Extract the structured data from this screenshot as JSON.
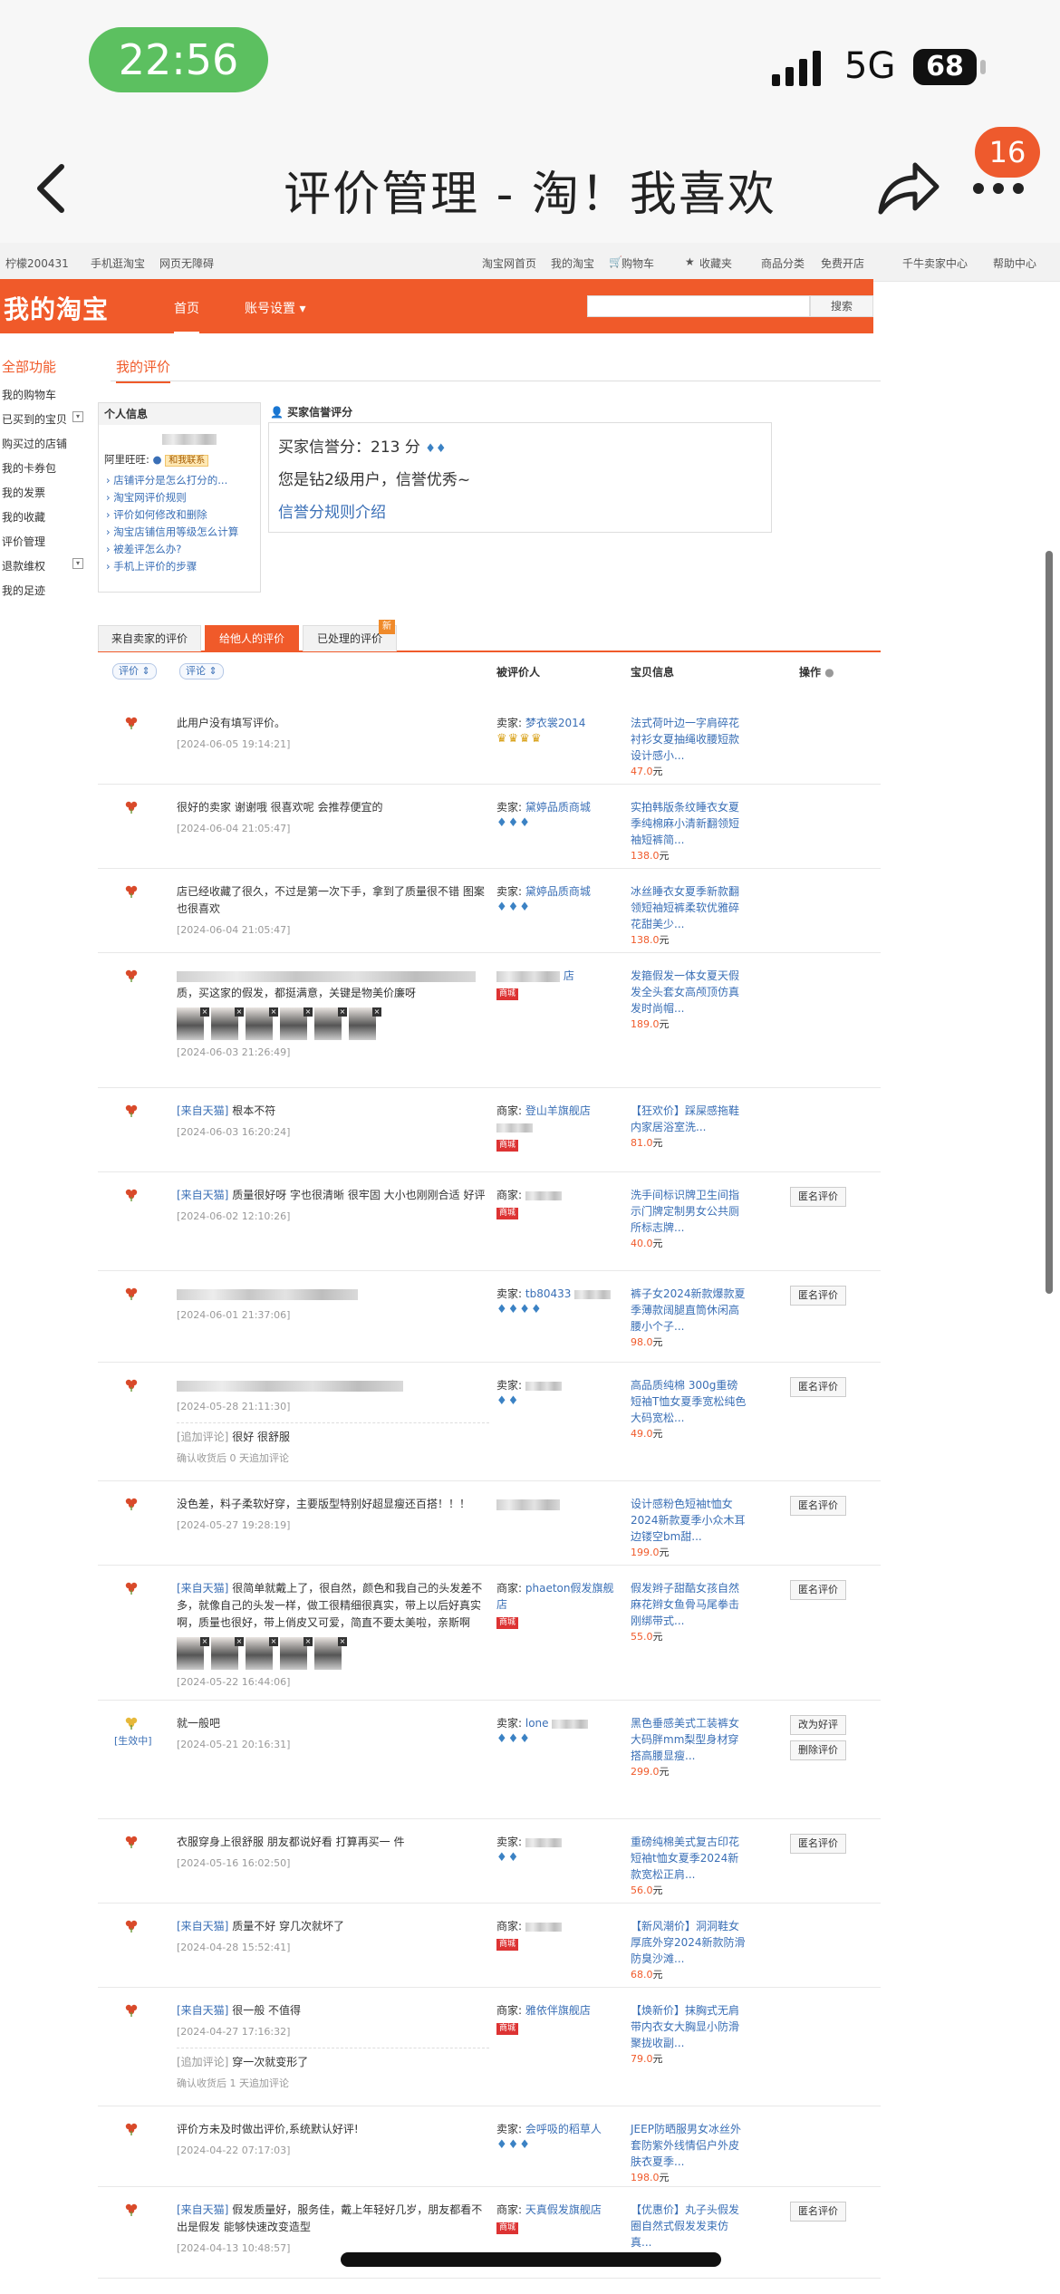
{
  "status_bar": {
    "time": "22:56",
    "network": "5G",
    "battery": "68"
  },
  "nav": {
    "title": "评价管理 - 淘！我喜欢",
    "badge": "16"
  },
  "topbar": {
    "user": "柠檬200431",
    "mobile": "手机逛淘宝",
    "accessible": "网页无障碍",
    "links": [
      "淘宝网首页",
      "我的淘宝",
      "购物车",
      "收藏夹",
      "商品分类",
      "免费开店",
      "千牛卖家中心",
      "帮助中心"
    ]
  },
  "header": {
    "logo": "我的淘宝",
    "home": "首页",
    "account": "账号设置",
    "search_btn": "搜索"
  },
  "sidebar": {
    "title": "全部功能",
    "items": [
      "我的购物车",
      "已买到的宝贝",
      "购买过的店铺",
      "我的卡券包",
      "我的发票",
      "我的收藏",
      "评价管理",
      "退款维权",
      "我的足迹"
    ]
  },
  "page_tab": "我的评价",
  "personal": {
    "title": "个人信息",
    "aliwangwang_label": "阿里旺旺:",
    "contact": "和我联系",
    "links": [
      "店铺评分是怎么打分的...",
      "淘宝网评价规则",
      "评价如何修改和删除",
      "淘宝店铺信用等级怎么计算",
      "被差评怎么办?",
      "手机上评价的步骤"
    ]
  },
  "credit": {
    "title": "买家信誉评分",
    "score_line": "买家信誉分：213 分",
    "level_line": "您是钻2级用户，信誉优秀~",
    "rules_link": "信誉分规则介绍"
  },
  "tabs": {
    "t1": "来自卖家的评价",
    "t2": "给他人的评价",
    "t3": "已处理的评价",
    "new": "新"
  },
  "columns": {
    "rating": "评价",
    "comment": "评论",
    "target": "被评价人",
    "item": "宝贝信息",
    "ops": "操作"
  },
  "yuan": "元",
  "reviews": [
    {
      "text": "此用户没有填写评价。",
      "date": "[2024-06-05 19:14:21]",
      "label": "卖家:",
      "name": "梦衣裳2014",
      "badge": "",
      "marks": "♛♛♛♛",
      "item": "法式荷叶边一字肩碎花衬衫女夏抽绳收腰短款设计感小...",
      "price": "47.0",
      "op": ""
    },
    {
      "text": "很好的卖家 谢谢哦 很喜欢呢 会推荐便宜的",
      "date": "[2024-06-04 21:05:47]",
      "label": "卖家:",
      "name": "黛婷品质商城",
      "badge": "",
      "marks": "♦♦♦",
      "item": "实拍韩版条纹睡衣女夏季纯棉麻小清新翻领短袖短裤简...",
      "price": "138.0",
      "op": ""
    },
    {
      "text": "店已经收藏了很久，不过是第一次下手，拿到了质量很不错 图案也很喜欢",
      "date": "[2024-06-04 21:05:47]",
      "label": "卖家:",
      "name": "黛婷品质商城",
      "badge": "",
      "marks": "♦♦♦",
      "item": "冰丝睡衣女夏季新款翻领短袖短裤柔软优雅碎花甜美少...",
      "price": "138.0",
      "op": ""
    },
    {
      "text": "质，买这家的假发，都挺满意，关键是物美价廉呀",
      "date": "[2024-06-03 21:26:49]",
      "label": "",
      "name": "店",
      "badge": "商城",
      "marks": "",
      "item": "发箍假发一体女夏天假发全头套女高颅顶仿真发时尚帽...",
      "price": "189.0",
      "op": ""
    },
    {
      "prefix": "[来自天猫]",
      "text": "根本不符",
      "date": "[2024-06-03 16:20:24]",
      "label": "商家:",
      "name": "登山羊旗舰店",
      "badge": "商城",
      "marks": "",
      "item": "【狂欢价】踩屎感拖鞋内家居浴室洗...",
      "price": "81.0",
      "op": ""
    },
    {
      "prefix": "[来自天猫]",
      "text": "质量很好呀 字也很清晰 很牢固 大小也刚刚合适 好评",
      "date": "[2024-06-02 12:10:26]",
      "label": "商家:",
      "name": "",
      "badge": "商城",
      "marks": "",
      "item": "洗手间标识牌卫生间指示门牌定制男女公共厕所标志牌...",
      "price": "40.0",
      "op": "匿名评价"
    },
    {
      "text": "",
      "date": "[2024-06-01 21:37:06]",
      "label": "卖家:",
      "name": "tb80433",
      "badge": "",
      "marks": "♦♦♦♦",
      "item": "裤子女2024新款爆款夏季薄款阔腿直筒休闲高腰小个子...",
      "price": "98.0",
      "op": "匿名评价"
    },
    {
      "text": "",
      "date": "[2024-05-28 21:11:30]",
      "append_label": "[追加评论]",
      "append": "很好 很舒服",
      "append_note": "确认收货后 0 天追加评论",
      "label": "卖家:",
      "name": "",
      "badge": "",
      "marks": "♦♦",
      "item": "高品质纯棉 300g重磅短袖T恤女夏季宽松纯色大码宽松...",
      "price": "49.0",
      "op": "匿名评价"
    },
    {
      "text": "没色差，料子柔软好穿，主要版型特别好超显瘦还百搭！！！",
      "date": "[2024-05-27 19:28:19]",
      "label": "",
      "name": "",
      "badge": "",
      "marks": "",
      "item": "设计感粉色短袖t恤女2024新款夏季小众木耳边镂空bm甜...",
      "price": "199.0",
      "op": "匿名评价"
    },
    {
      "prefix": "[来自天猫]",
      "text": "很简单就戴上了，很自然，颜色和我自己的头发差不多，就像自己的头发一样，做工很精细很真实，带上以后好真实啊，质量也很好，带上俏皮又可爱，简直不要太美啦，亲斯啊",
      "date": "[2024-05-22 16:44:06]",
      "label": "商家:",
      "name": "phaeton假发旗舰店",
      "badge": "商城",
      "marks": "",
      "item": "假发辫子甜酷女孩自然麻花辫女鱼骨马尾拳击刚绑带式...",
      "price": "55.0",
      "op": "匿名评价"
    },
    {
      "text": "就一般吧",
      "date": "[2024-05-21 20:16:31]",
      "effective": "[生效中]",
      "label": "卖家:",
      "name": "lone",
      "badge": "",
      "marks": "♦♦♦",
      "item": "黑色垂感美式工装裤女大码胖mm梨型身材穿搭高腰显瘦...",
      "price": "299.0",
      "op": "改为好评",
      "op2": "删除评价"
    },
    {
      "text": "衣服穿身上很舒服 朋友都说好看 打算再买一 件",
      "date": "[2024-05-16 16:02:50]",
      "label": "卖家:",
      "name": "",
      "badge": "",
      "marks": "♦♦",
      "item": "重磅纯棉美式复古印花短袖t恤女夏季2024新款宽松正肩...",
      "price": "56.0",
      "op": "匿名评价"
    },
    {
      "prefix": "[来自天猫]",
      "text": "质量不好 穿几次就坏了",
      "date": "[2024-04-28 15:52:41]",
      "label": "商家:",
      "name": "",
      "badge": "商城",
      "marks": "",
      "item": "【新风潮价】洞洞鞋女厚底外穿2024新款防滑防臭沙滩...",
      "price": "68.0",
      "op": ""
    },
    {
      "prefix": "[来自天猫]",
      "text": "很一般 不值得",
      "date": "[2024-04-27 17:16:32]",
      "append_label": "[追加评论]",
      "append": "穿一次就变形了",
      "append_note": "确认收货后 1 天追加评论",
      "label": "商家:",
      "name": "雅依伴旗舰店",
      "badge": "商城",
      "marks": "",
      "item": "【焕新价】抹胸式无肩带内衣女大胸显小防滑聚拢收副...",
      "price": "79.0",
      "op": ""
    },
    {
      "text": "评价方未及时做出评价,系统默认好评!",
      "date": "[2024-04-22 07:17:03]",
      "label": "卖家:",
      "name": "会呼吸的稻草人",
      "badge": "",
      "marks": "♦♦♦",
      "item": "JEEP防晒服男女冰丝外套防紫外线情侣户外皮肤衣夏季...",
      "price": "198.0",
      "op": ""
    },
    {
      "prefix": "[来自天猫]",
      "text": "假发质量好，服务佳，戴上年轻好几岁，朋友都看不出是假发 能够快速改变造型",
      "date": "[2024-04-13 10:48:57]",
      "label": "商家:",
      "name": "天真假发旗舰店",
      "badge": "商城",
      "marks": "",
      "item": "【优惠价】丸子头假发圈自然式假发发束仿真...",
      "price": "",
      "op": "匿名评价"
    }
  ]
}
